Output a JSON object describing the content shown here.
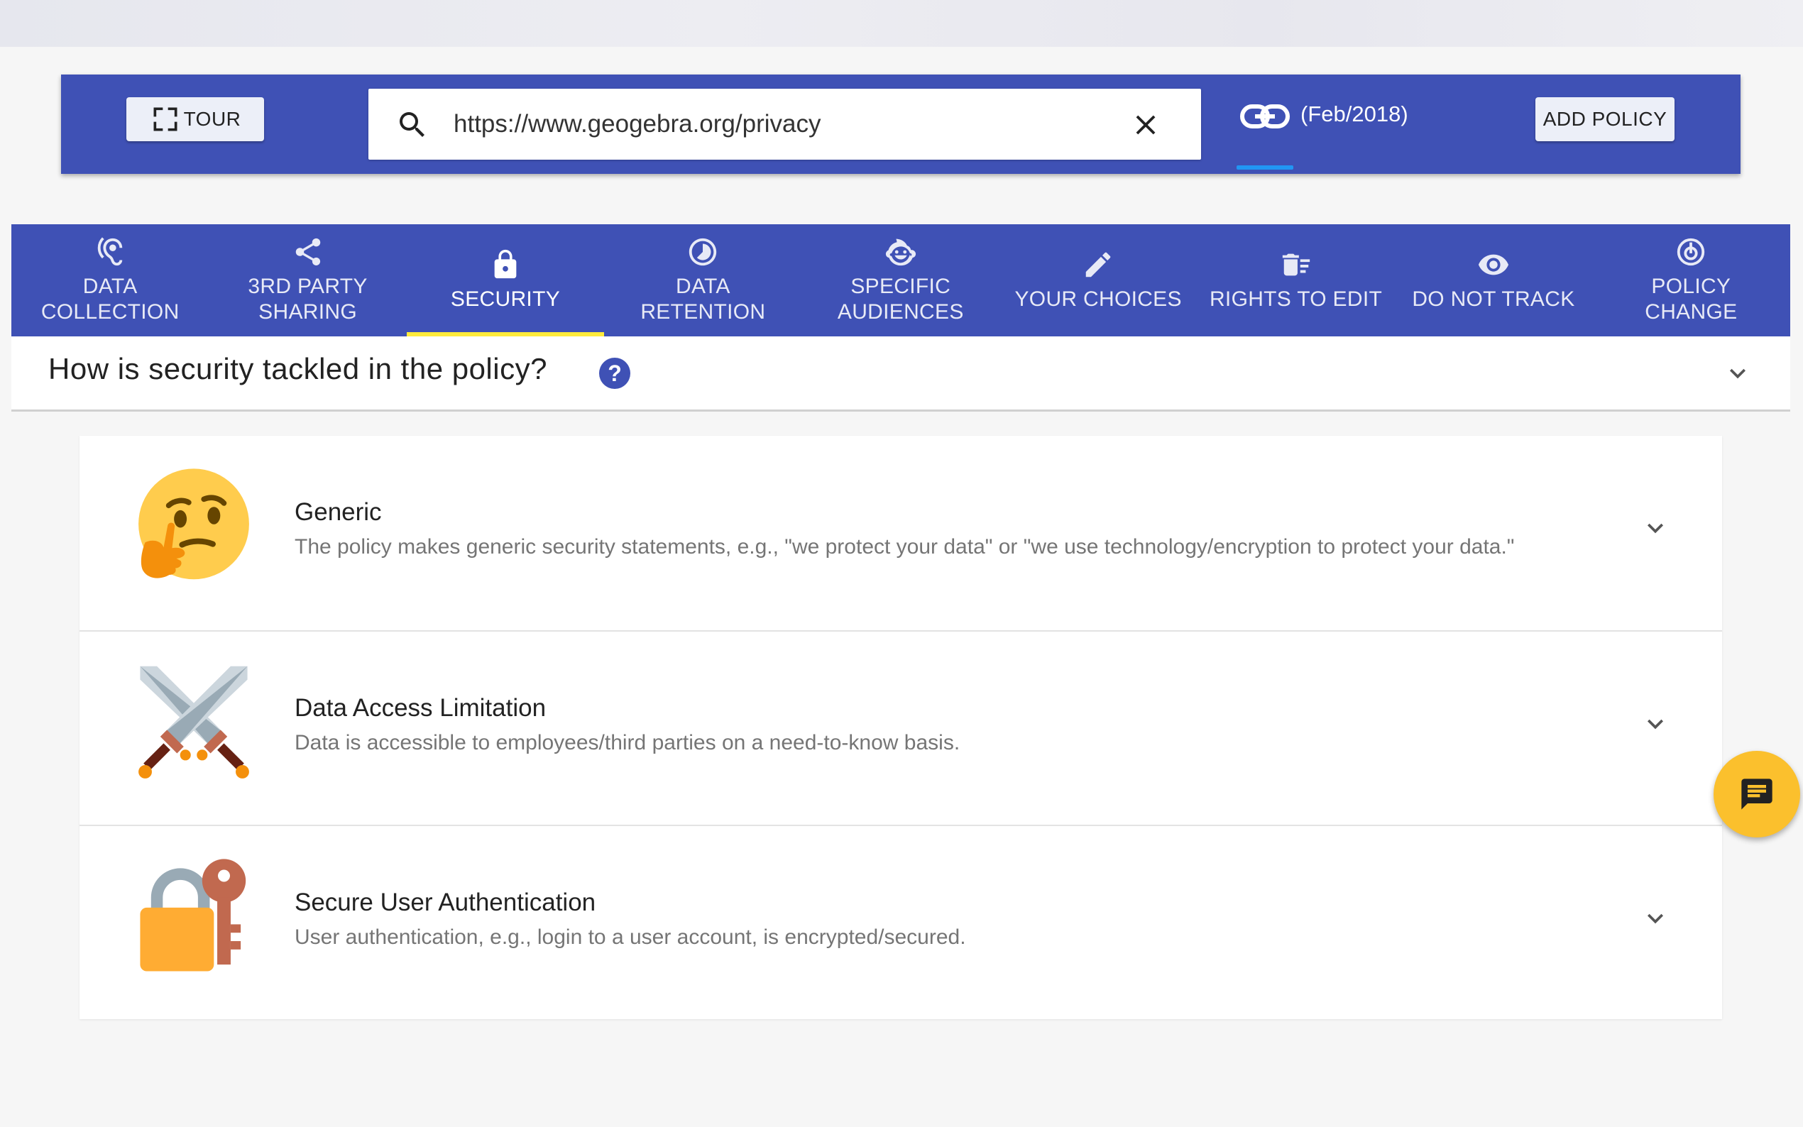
{
  "toolbar": {
    "tour_label": "TOUR",
    "search": {
      "value": "https://www.geogebra.org/privacy",
      "placeholder": ""
    },
    "policy_date": "(Feb/2018)",
    "add_policy_label": "ADD POLICY"
  },
  "tabs": [
    {
      "label": "DATA\nCOLLECTION",
      "icon": "ear-icon"
    },
    {
      "label": "3RD PARTY\nSHARING",
      "icon": "share-icon"
    },
    {
      "label": "SECURITY",
      "icon": "lock-icon",
      "active": true
    },
    {
      "label": "DATA\nRETENTION",
      "icon": "timelapse-icon"
    },
    {
      "label": "SPECIFIC\nAUDIENCES",
      "icon": "child-face-icon"
    },
    {
      "label": "YOUR CHOICES",
      "icon": "pencil-icon"
    },
    {
      "label": "RIGHTS TO EDIT",
      "icon": "delete-sweep-icon"
    },
    {
      "label": "DO NOT TRACK",
      "icon": "eye-icon"
    },
    {
      "label": "POLICY\nCHANGE",
      "icon": "change-history-icon"
    }
  ],
  "question": {
    "text": "How is security tackled in the policy?"
  },
  "items": [
    {
      "title": "Generic",
      "description": "The policy makes generic security statements, e.g., \"we protect your data\" or \"we use technology/encryption to protect your data.\"",
      "icon": "thinking-face-icon"
    },
    {
      "title": "Data Access Limitation",
      "description": "Data is accessible to employees/third parties on a need-to-know basis.",
      "icon": "crossed-swords-icon"
    },
    {
      "title": "Secure User Authentication",
      "description": "User authentication, e.g., login to a user account, is encrypted/secured.",
      "icon": "lock-with-key-icon"
    }
  ],
  "colors": {
    "primary": "#3f51b5",
    "active_tab_indicator": "#ffeb3b",
    "link_underline": "#2196f3",
    "fab": "#fbc02d"
  }
}
